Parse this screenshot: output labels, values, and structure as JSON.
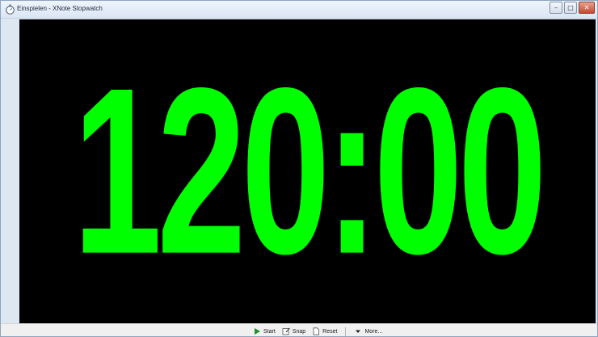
{
  "window": {
    "title": "Einspielen - XNote Stopwatch",
    "min_glyph": "–",
    "max_glyph": "□",
    "close_glyph": "✕"
  },
  "display": {
    "time": "120:00",
    "text_color": "#00ff00",
    "background_color": "#000000"
  },
  "toolbar": {
    "start_label": "Start",
    "snap_label": "Snap",
    "reset_label": "Reset",
    "more_label": "More..."
  },
  "icons": {
    "app": "stopwatch-icon",
    "start": "play-icon",
    "snap": "snapshot-icon",
    "reset": "page-icon",
    "more": "dropdown-arrow-icon"
  }
}
